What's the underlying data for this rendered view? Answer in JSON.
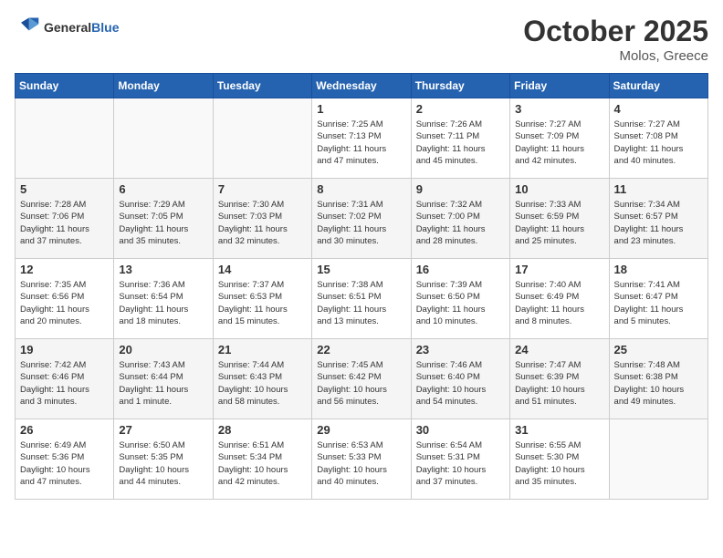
{
  "header": {
    "logo_line1": "General",
    "logo_line2": "Blue",
    "month": "October 2025",
    "location": "Molos, Greece"
  },
  "weekdays": [
    "Sunday",
    "Monday",
    "Tuesday",
    "Wednesday",
    "Thursday",
    "Friday",
    "Saturday"
  ],
  "weeks": [
    [
      {
        "day": "",
        "info": ""
      },
      {
        "day": "",
        "info": ""
      },
      {
        "day": "",
        "info": ""
      },
      {
        "day": "1",
        "info": "Sunrise: 7:25 AM\nSunset: 7:13 PM\nDaylight: 11 hours\nand 47 minutes."
      },
      {
        "day": "2",
        "info": "Sunrise: 7:26 AM\nSunset: 7:11 PM\nDaylight: 11 hours\nand 45 minutes."
      },
      {
        "day": "3",
        "info": "Sunrise: 7:27 AM\nSunset: 7:09 PM\nDaylight: 11 hours\nand 42 minutes."
      },
      {
        "day": "4",
        "info": "Sunrise: 7:27 AM\nSunset: 7:08 PM\nDaylight: 11 hours\nand 40 minutes."
      }
    ],
    [
      {
        "day": "5",
        "info": "Sunrise: 7:28 AM\nSunset: 7:06 PM\nDaylight: 11 hours\nand 37 minutes."
      },
      {
        "day": "6",
        "info": "Sunrise: 7:29 AM\nSunset: 7:05 PM\nDaylight: 11 hours\nand 35 minutes."
      },
      {
        "day": "7",
        "info": "Sunrise: 7:30 AM\nSunset: 7:03 PM\nDaylight: 11 hours\nand 32 minutes."
      },
      {
        "day": "8",
        "info": "Sunrise: 7:31 AM\nSunset: 7:02 PM\nDaylight: 11 hours\nand 30 minutes."
      },
      {
        "day": "9",
        "info": "Sunrise: 7:32 AM\nSunset: 7:00 PM\nDaylight: 11 hours\nand 28 minutes."
      },
      {
        "day": "10",
        "info": "Sunrise: 7:33 AM\nSunset: 6:59 PM\nDaylight: 11 hours\nand 25 minutes."
      },
      {
        "day": "11",
        "info": "Sunrise: 7:34 AM\nSunset: 6:57 PM\nDaylight: 11 hours\nand 23 minutes."
      }
    ],
    [
      {
        "day": "12",
        "info": "Sunrise: 7:35 AM\nSunset: 6:56 PM\nDaylight: 11 hours\nand 20 minutes."
      },
      {
        "day": "13",
        "info": "Sunrise: 7:36 AM\nSunset: 6:54 PM\nDaylight: 11 hours\nand 18 minutes."
      },
      {
        "day": "14",
        "info": "Sunrise: 7:37 AM\nSunset: 6:53 PM\nDaylight: 11 hours\nand 15 minutes."
      },
      {
        "day": "15",
        "info": "Sunrise: 7:38 AM\nSunset: 6:51 PM\nDaylight: 11 hours\nand 13 minutes."
      },
      {
        "day": "16",
        "info": "Sunrise: 7:39 AM\nSunset: 6:50 PM\nDaylight: 11 hours\nand 10 minutes."
      },
      {
        "day": "17",
        "info": "Sunrise: 7:40 AM\nSunset: 6:49 PM\nDaylight: 11 hours\nand 8 minutes."
      },
      {
        "day": "18",
        "info": "Sunrise: 7:41 AM\nSunset: 6:47 PM\nDaylight: 11 hours\nand 5 minutes."
      }
    ],
    [
      {
        "day": "19",
        "info": "Sunrise: 7:42 AM\nSunset: 6:46 PM\nDaylight: 11 hours\nand 3 minutes."
      },
      {
        "day": "20",
        "info": "Sunrise: 7:43 AM\nSunset: 6:44 PM\nDaylight: 11 hours\nand 1 minute."
      },
      {
        "day": "21",
        "info": "Sunrise: 7:44 AM\nSunset: 6:43 PM\nDaylight: 10 hours\nand 58 minutes."
      },
      {
        "day": "22",
        "info": "Sunrise: 7:45 AM\nSunset: 6:42 PM\nDaylight: 10 hours\nand 56 minutes."
      },
      {
        "day": "23",
        "info": "Sunrise: 7:46 AM\nSunset: 6:40 PM\nDaylight: 10 hours\nand 54 minutes."
      },
      {
        "day": "24",
        "info": "Sunrise: 7:47 AM\nSunset: 6:39 PM\nDaylight: 10 hours\nand 51 minutes."
      },
      {
        "day": "25",
        "info": "Sunrise: 7:48 AM\nSunset: 6:38 PM\nDaylight: 10 hours\nand 49 minutes."
      }
    ],
    [
      {
        "day": "26",
        "info": "Sunrise: 6:49 AM\nSunset: 5:36 PM\nDaylight: 10 hours\nand 47 minutes."
      },
      {
        "day": "27",
        "info": "Sunrise: 6:50 AM\nSunset: 5:35 PM\nDaylight: 10 hours\nand 44 minutes."
      },
      {
        "day": "28",
        "info": "Sunrise: 6:51 AM\nSunset: 5:34 PM\nDaylight: 10 hours\nand 42 minutes."
      },
      {
        "day": "29",
        "info": "Sunrise: 6:53 AM\nSunset: 5:33 PM\nDaylight: 10 hours\nand 40 minutes."
      },
      {
        "day": "30",
        "info": "Sunrise: 6:54 AM\nSunset: 5:31 PM\nDaylight: 10 hours\nand 37 minutes."
      },
      {
        "day": "31",
        "info": "Sunrise: 6:55 AM\nSunset: 5:30 PM\nDaylight: 10 hours\nand 35 minutes."
      },
      {
        "day": "",
        "info": ""
      }
    ]
  ]
}
